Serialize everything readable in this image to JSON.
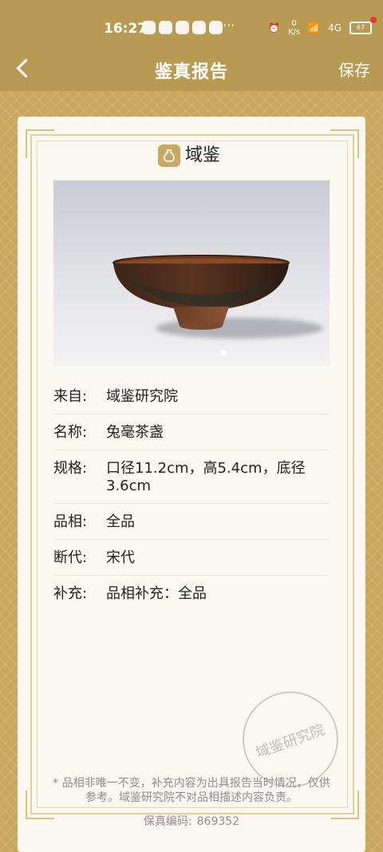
{
  "status_bar": {
    "time": "16:27",
    "net_speed_value": "0",
    "net_speed_unit": "K/s",
    "signal": "4G",
    "battery": "67"
  },
  "header": {
    "title": "鉴真报告",
    "save_label": "保存"
  },
  "brand": {
    "name": "域鉴"
  },
  "photo": {
    "alt_subject": "tea-bowl",
    "active_dot": 1
  },
  "details": [
    {
      "label": "来自:",
      "value": "域鉴研究院"
    },
    {
      "label": "名称:",
      "value": "兔毫茶盏"
    },
    {
      "label": "规格:",
      "value": "口径11.2cm，高5.4cm，底径3.6cm"
    },
    {
      "label": "品相:",
      "value": "全品"
    },
    {
      "label": "断代:",
      "value": "宋代"
    },
    {
      "label": "补充:",
      "value": "品相补充：全品"
    }
  ],
  "stamp": {
    "text": "域鉴研究院"
  },
  "disclaimer": "* 品相非唯一不变，补充内容为出具报告当时情况，仅供参考。域鉴研究院不对品相描述内容负责。",
  "serial": {
    "label": "保真编码:",
    "value": "869352"
  },
  "colors": {
    "header_bg": "#b99a52",
    "card_bg": "#fbf8f1",
    "frame": "#e4cf93"
  }
}
